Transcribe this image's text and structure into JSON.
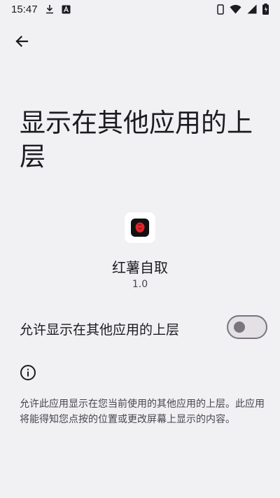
{
  "status_bar": {
    "time": "15:47"
  },
  "header": {
    "back_icon": "arrow-left-icon"
  },
  "page": {
    "title": "显示在其他应用的上层"
  },
  "app": {
    "name": "红薯自取",
    "version": "1.0"
  },
  "setting": {
    "label": "允许显示在其他应用的上层",
    "enabled": false
  },
  "info": {
    "icon": "info-icon",
    "text": "允许此应用显示在您当前使用的其他应用的上层。此应用将能得知您点按的位置或更改屏幕上显示的内容。"
  },
  "colors": {
    "background": "#f1f0f3",
    "text_primary": "#1c1b1f",
    "text_secondary": "#49454f",
    "toggle_outline": "#79747e"
  }
}
